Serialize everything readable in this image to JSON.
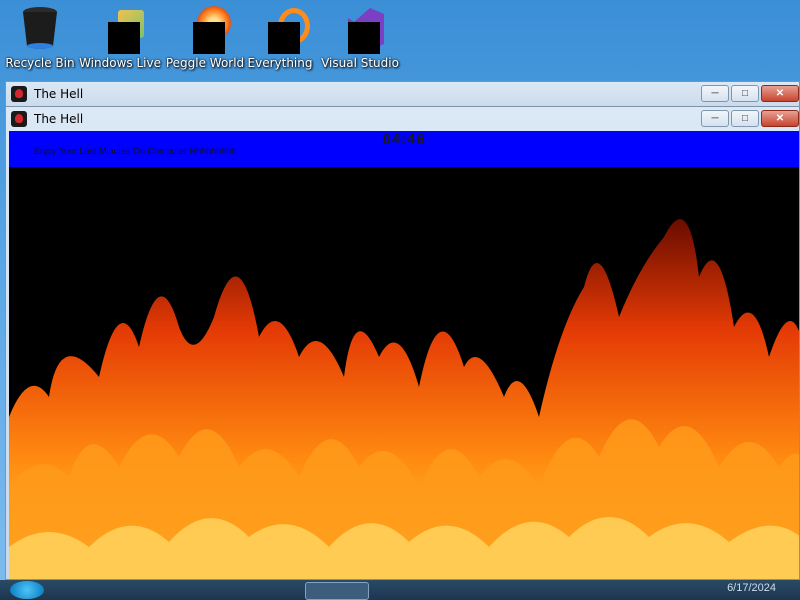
{
  "desktop": {
    "icons": [
      {
        "label": "Recycle Bin"
      },
      {
        "label": "Windows Live"
      },
      {
        "label": "Peggle World"
      },
      {
        "label": "Everything"
      },
      {
        "label": "Visual Studio"
      }
    ]
  },
  "windows": [
    {
      "title": "The Hell"
    },
    {
      "title": "The Hell"
    }
  ],
  "app": {
    "timer": "04:46",
    "warning": "Enjoy Your Last Minutes On Computer Hhhhhhhhh"
  },
  "taskbar": {
    "date": "6/17/2024"
  },
  "colors": {
    "banner": "#0000ff",
    "flame_core": "#ffb300",
    "flame_mid": "#ff5a00",
    "flame_dark": "#b31200"
  }
}
